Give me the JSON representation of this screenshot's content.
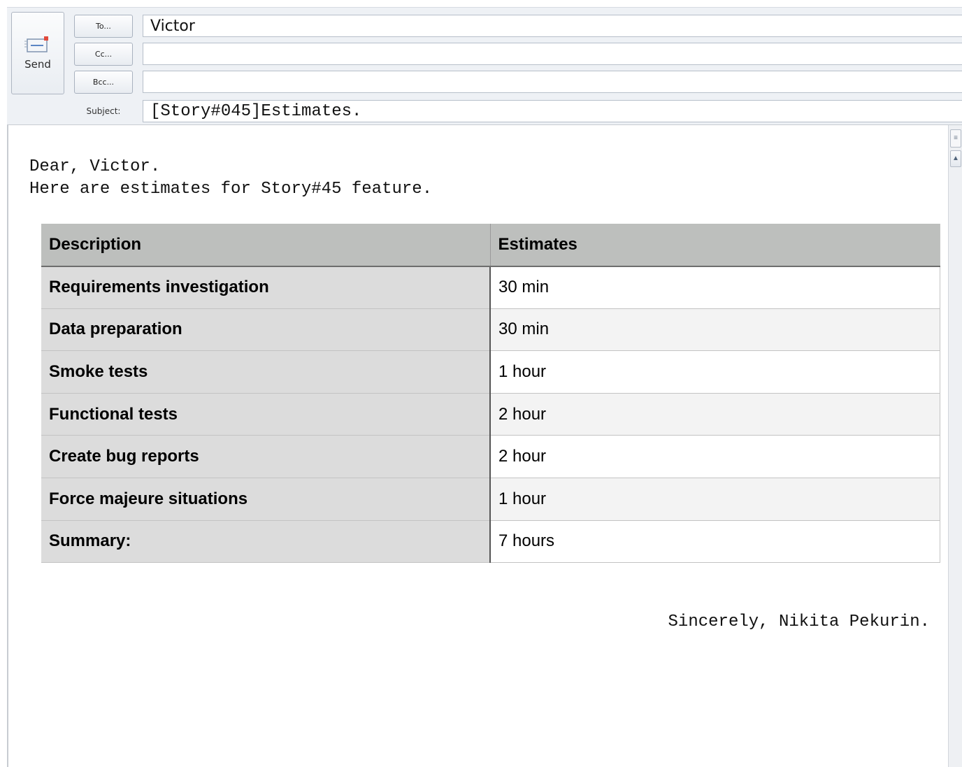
{
  "header": {
    "send_label": "Send",
    "to_button": "To...",
    "cc_button": "Cc...",
    "bcc_button": "Bcc...",
    "subject_label": "Subject:",
    "to_value": "Victor",
    "cc_value": "",
    "bcc_value": "",
    "subject_value": "[Story#045]Estimates."
  },
  "message": {
    "greeting_line1": "Dear, Victor.",
    "greeting_line2": "Here are estimates for Story#45 feature.",
    "table": {
      "headers": [
        "Description",
        "Estimates"
      ],
      "rows": [
        [
          "Requirements investigation",
          "30 min"
        ],
        [
          "Data preparation",
          "30 min"
        ],
        [
          "Smoke tests",
          "1 hour"
        ],
        [
          "Functional tests",
          "2 hour"
        ],
        [
          "Create bug reports",
          "2 hour"
        ],
        [
          "Force majeure situations",
          "1 hour"
        ],
        [
          "Summary:",
          "7 hours"
        ]
      ]
    },
    "signature": "Sincerely, Nikita Pekurin."
  },
  "icons": {
    "send": "envelope-send-icon",
    "scroll_up": "scroll-up-arrow-icon"
  },
  "colors": {
    "header_bg": "#eef1f5",
    "table_header_bg": "#bdbfbd",
    "table_label_bg": "#dcdcdc"
  }
}
